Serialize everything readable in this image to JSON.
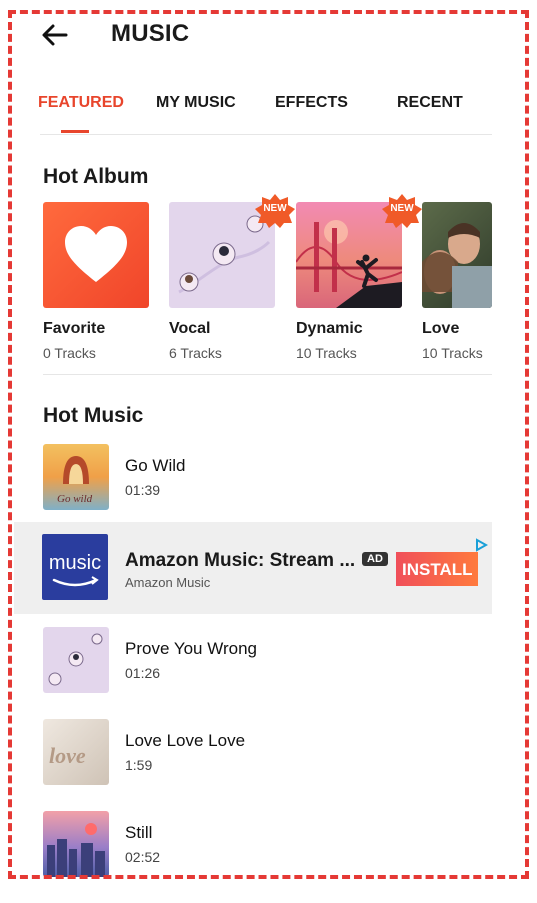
{
  "header": {
    "title": "MUSIC",
    "back_icon": "arrow-left-icon"
  },
  "tabs": [
    {
      "label": "FEATURED",
      "active": true
    },
    {
      "label": "MY MUSIC",
      "active": false
    },
    {
      "label": "EFFECTS",
      "active": false
    },
    {
      "label": "RECENT",
      "active": false
    }
  ],
  "hot_album": {
    "title": "Hot Album",
    "albums": [
      {
        "name": "Favorite",
        "count": "0 Tracks",
        "badge": ""
      },
      {
        "name": "Vocal",
        "count": "6 Tracks",
        "badge": "NEW"
      },
      {
        "name": "Dynamic",
        "count": "10 Tracks",
        "badge": "NEW"
      },
      {
        "name": "Love",
        "count": "10 Tracks",
        "badge": ""
      }
    ]
  },
  "hot_music": {
    "title": "Hot Music",
    "tracks": [
      {
        "title": "Go Wild",
        "duration": "01:39"
      },
      {
        "title": "Prove You Wrong",
        "duration": "01:26"
      },
      {
        "title": "Love Love Love",
        "duration": "1:59"
      },
      {
        "title": "Still",
        "duration": "02:52"
      }
    ]
  },
  "ad": {
    "logo_text": "music",
    "title": "Amazon Music: Stream ...",
    "badge": "AD",
    "subtitle": "Amazon Music",
    "cta": "INSTALL"
  },
  "colors": {
    "accent": "#e8452c",
    "frame": "#e53935",
    "ad_bg": "#efefef"
  }
}
